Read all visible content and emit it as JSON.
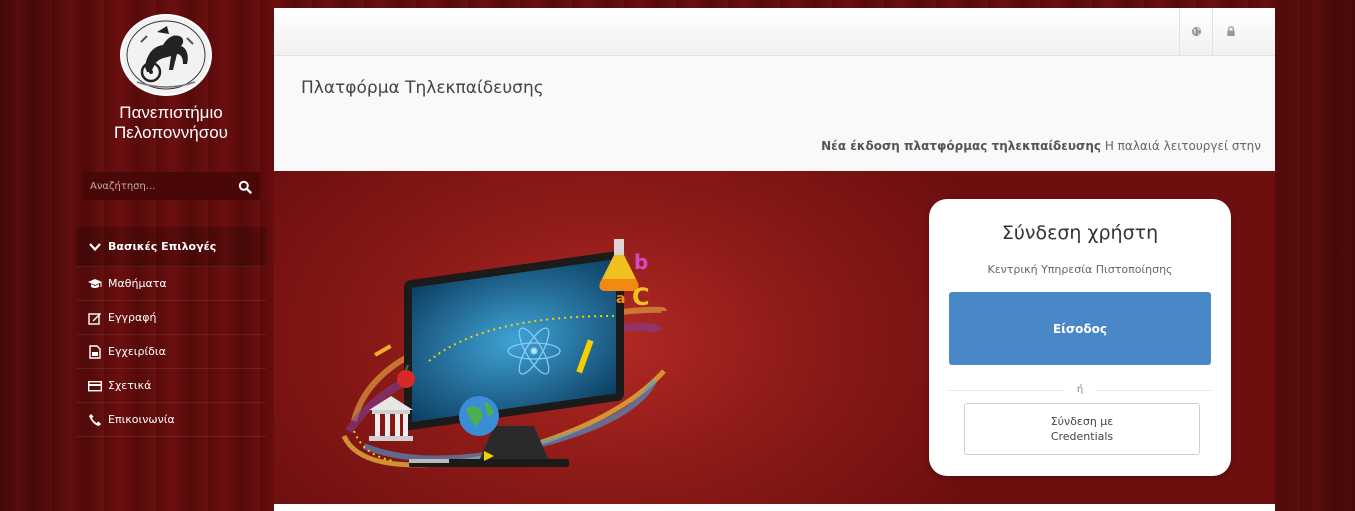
{
  "sidebar": {
    "logo_alt": "ΠΕΛΟΠ",
    "university_line1": "Πανεπιστήμιο",
    "university_line2": "Πελοποννήσου",
    "search": {
      "placeholder": "Αναζήτηση..."
    },
    "menu_header": {
      "label": "Βασικές Επιλογές",
      "icon": "chevron-down-icon"
    },
    "items": [
      {
        "label": "Μαθήματα",
        "icon": "graduation-cap-icon"
      },
      {
        "label": "Εγγραφή",
        "icon": "edit-icon"
      },
      {
        "label": "Εγχειρίδια",
        "icon": "document-icon"
      },
      {
        "label": "Σχετικά",
        "icon": "credit-card-icon"
      },
      {
        "label": "Επικοινωνία",
        "icon": "phone-icon"
      }
    ]
  },
  "topbar": {
    "language_icon": "globe-icon",
    "login_icon": "lock-icon"
  },
  "header": {
    "title": "Πλατφόρμα Τηλεκπαίδευσης",
    "notice_bold": "Νέα έκδοση πλατφόρμας τηλεκπαίδευσης",
    "notice_rest": " Η παλαιά λειτουργεί στην"
  },
  "login": {
    "title": "Σύνδεση χρήστη",
    "subtitle": "Κεντρική Υπηρεσία Πιστοποίησης",
    "primary_button": "Είσοδος",
    "divider": "ή",
    "credentials_line1": "Σύνδεση με",
    "credentials_line2": "Credentials"
  },
  "colors": {
    "background": "#5e0c0c",
    "hero": "#8e1b18",
    "primary_button": "#4a87c6",
    "white": "#ffffff"
  }
}
